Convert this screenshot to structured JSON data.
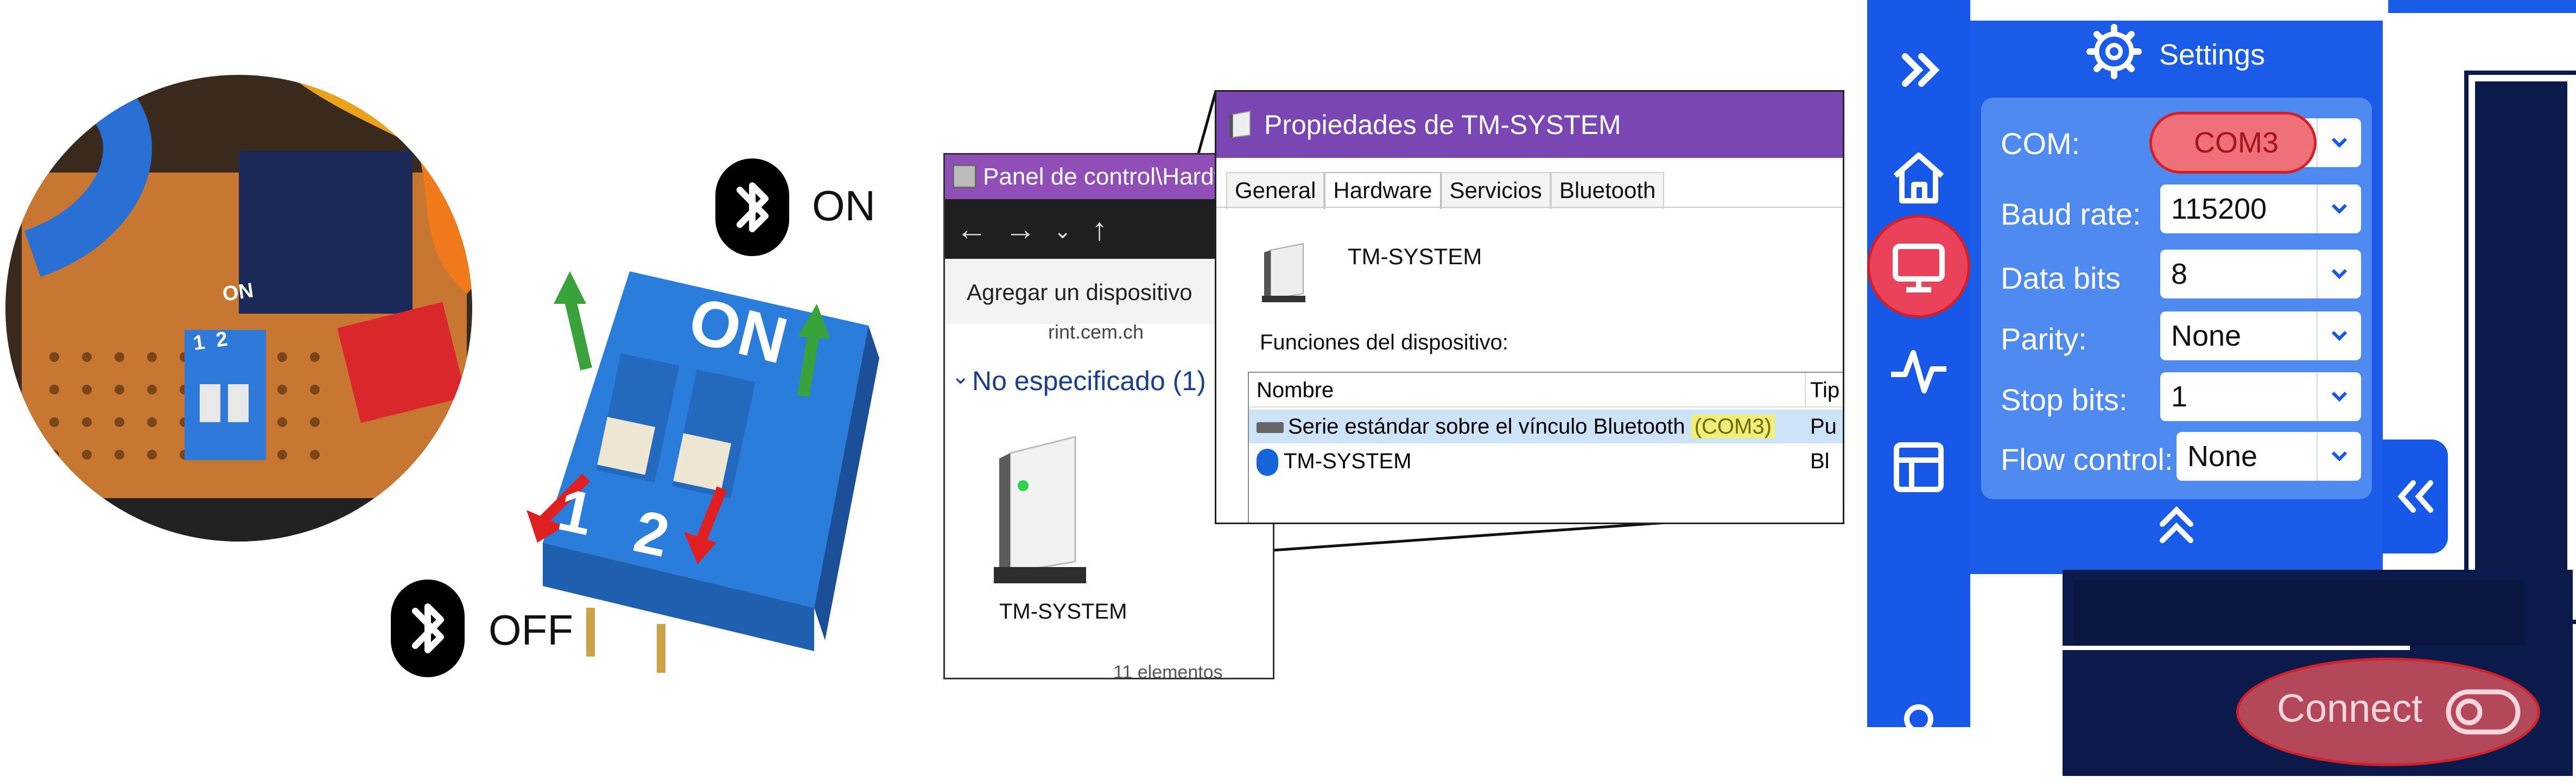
{
  "bluetooth_states": {
    "on_label": "ON",
    "off_label": "OFF"
  },
  "dip_switch": {
    "top_marking": "ON",
    "switch_numbers": [
      "1",
      "2"
    ],
    "photo_switch_marking": "ON",
    "photo_switch_numbers": "1  2"
  },
  "explorer": {
    "title": "Panel de control\\Hardw",
    "add_device_label": "Agregar un dispositivo",
    "partial_item_label": "rint.cem.ch",
    "group_label": "No especificado (1)",
    "device_label": "TM-SYSTEM",
    "footer_count": "11 elementos"
  },
  "properties": {
    "title": "Propiedades de TM-SYSTEM",
    "tabs": [
      "General",
      "Hardware",
      "Servicios",
      "Bluetooth"
    ],
    "active_tab": "Hardware",
    "device_name": "TM-SYSTEM",
    "functions_label": "Funciones del dispositivo:",
    "columns": [
      "Nombre",
      "Tip"
    ],
    "rows": [
      {
        "name": "Serie estándar sobre el vínculo Bluetooth",
        "port": "(COM3)",
        "type": "Pu"
      },
      {
        "name": "TM-SYSTEM",
        "port": "",
        "type": "Bl"
      }
    ]
  },
  "app": {
    "settings_title": "Settings",
    "fields": [
      {
        "label": "COM:",
        "value": "COM3"
      },
      {
        "label": "Baud rate:",
        "value": "115200"
      },
      {
        "label": "Data bits",
        "value": "8"
      },
      {
        "label": "Parity:",
        "value": "None"
      },
      {
        "label": "Stop bits:",
        "value": "1"
      },
      {
        "label": "Flow control:",
        "value": "None"
      }
    ],
    "connect_label": "Connect",
    "colors": {
      "primary": "#1858e8",
      "panel": "#4f8af0",
      "highlight": "#e9425a",
      "dark": "#0b1a4a"
    }
  }
}
